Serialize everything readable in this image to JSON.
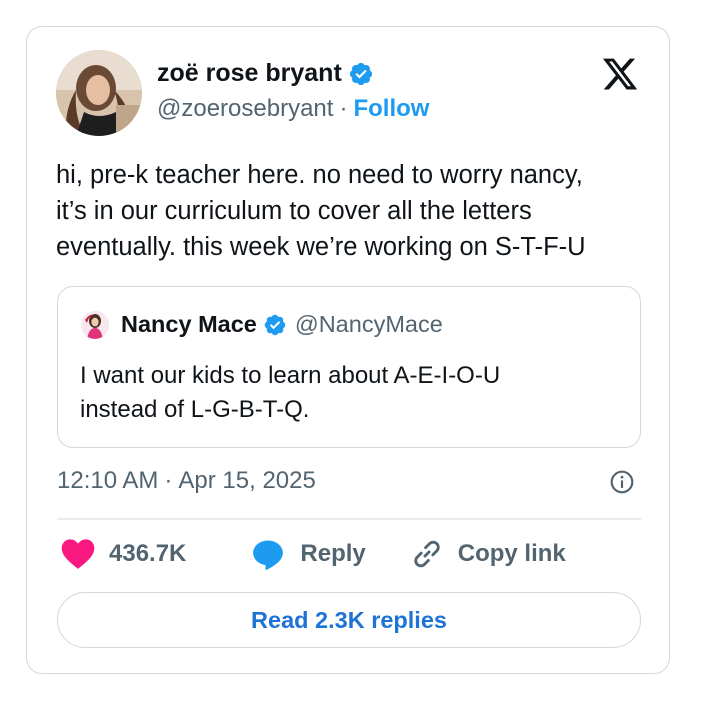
{
  "author": {
    "name": "zoë rose bryant",
    "handle": "@zoerosebryant",
    "separator": "·",
    "follow_label": "Follow",
    "avatar_icon": "profile-photo",
    "verified_icon": "verified-badge-icon"
  },
  "platform_icon": "x-logo-icon",
  "tweet": {
    "lines": [
      "hi, pre-k teacher here. no need to worry nancy,",
      "it’s in our curriculum to cover all the letters",
      "eventually. this week we’re working on S-T-F-U"
    ]
  },
  "quote": {
    "name": "Nancy Mace",
    "handle": "@NancyMace",
    "lines": [
      "I want our kids to learn about A-E-I-O-U",
      "instead of L-G-B-T-Q."
    ]
  },
  "meta": {
    "time": "12:10 AM",
    "separator": "·",
    "date": "Apr 15, 2025"
  },
  "actions": {
    "likes": "436.7K",
    "reply_label": "Reply",
    "copy_link_label": "Copy link"
  },
  "read_replies_label": "Read 2.3K replies",
  "colors": {
    "accent": "#1d9bf0",
    "heart": "#f91880",
    "replies_text": "#1d73d6",
    "border": "#cfd9de",
    "muted": "#536471"
  }
}
